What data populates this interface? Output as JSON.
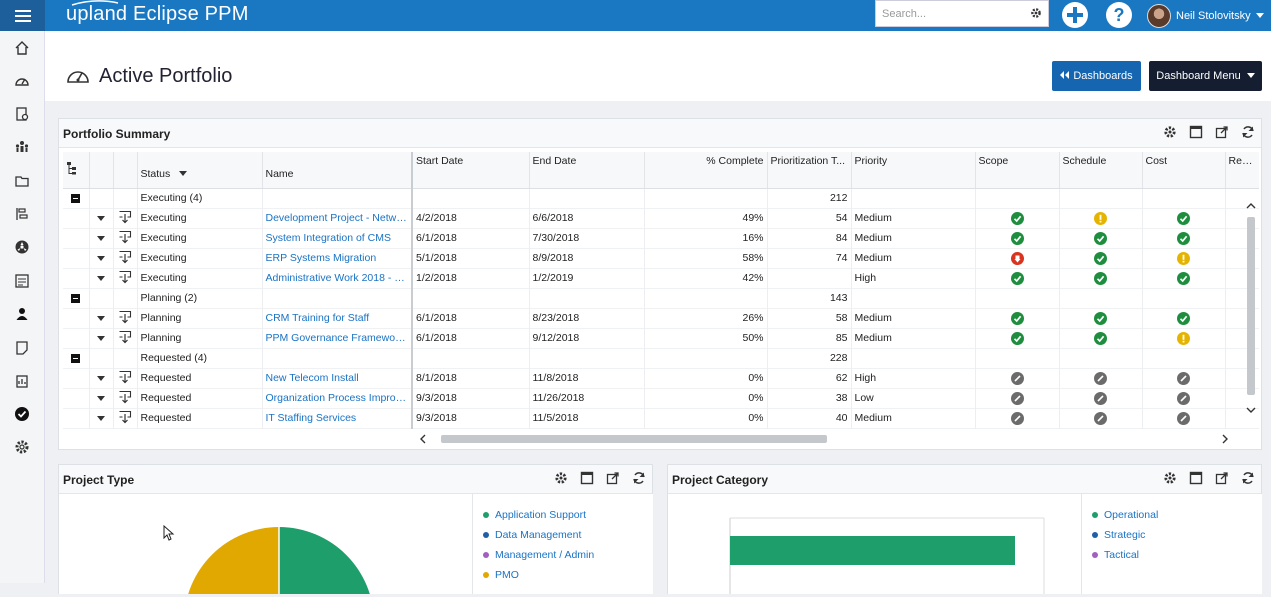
{
  "app": {
    "brand": "upland Eclipse PPM",
    "search_placeholder": "Search...",
    "user_name": "Neil Stolovitsky"
  },
  "page": {
    "title": "Active Portfolio",
    "dashboards_button": "Dashboards",
    "dashboard_menu_button": "Dashboard Menu"
  },
  "portfolio_summary": {
    "title": "Portfolio Summary",
    "columns": [
      "Status",
      "Name",
      "Start Date",
      "End Date",
      "% Complete",
      "Prioritization T...",
      "Priority",
      "Scope",
      "Schedule",
      "Cost",
      "Resou"
    ],
    "groups": [
      {
        "label": "Executing (4)",
        "total": "212",
        "rows": [
          {
            "status": "Executing",
            "name": "Development Project - Network...",
            "start": "4/2/2018",
            "end": "6/6/2018",
            "pct": "49%",
            "prio_t": "54",
            "priority": "Medium",
            "scope": "green",
            "schedule": "yellow",
            "cost": "green"
          },
          {
            "status": "Executing",
            "name": "System Integration of CMS",
            "start": "6/1/2018",
            "end": "7/30/2018",
            "pct": "16%",
            "prio_t": "84",
            "priority": "Medium",
            "scope": "green",
            "schedule": "green",
            "cost": "green"
          },
          {
            "status": "Executing",
            "name": "ERP Systems Migration",
            "start": "5/1/2018",
            "end": "8/9/2018",
            "pct": "58%",
            "prio_t": "74",
            "priority": "Medium",
            "scope": "red",
            "schedule": "green",
            "cost": "yellow"
          },
          {
            "status": "Executing",
            "name": "Administrative Work 2018 - Neil...",
            "start": "1/2/2018",
            "end": "1/2/2019",
            "pct": "42%",
            "prio_t": "",
            "priority": "High",
            "scope": "green",
            "schedule": "green",
            "cost": "green"
          }
        ]
      },
      {
        "label": "Planning (2)",
        "total": "143",
        "rows": [
          {
            "status": "Planning",
            "name": "CRM Training for Staff",
            "start": "6/1/2018",
            "end": "8/23/2018",
            "pct": "26%",
            "prio_t": "58",
            "priority": "Medium",
            "scope": "green",
            "schedule": "green",
            "cost": "green"
          },
          {
            "status": "Planning",
            "name": "PPM Governance Framework De...",
            "start": "6/1/2018",
            "end": "9/12/2018",
            "pct": "50%",
            "prio_t": "85",
            "priority": "Medium",
            "scope": "green",
            "schedule": "green",
            "cost": "yellow"
          }
        ]
      },
      {
        "label": "Requested (4)",
        "total": "228",
        "rows": [
          {
            "status": "Requested",
            "name": "New Telecom Install",
            "start": "8/1/2018",
            "end": "11/8/2018",
            "pct": "0%",
            "prio_t": "62",
            "priority": "High",
            "scope": "none",
            "schedule": "none",
            "cost": "none"
          },
          {
            "status": "Requested",
            "name": "Organization Process Improvem...",
            "start": "9/3/2018",
            "end": "11/26/2018",
            "pct": "0%",
            "prio_t": "38",
            "priority": "Low",
            "scope": "none",
            "schedule": "none",
            "cost": "none"
          },
          {
            "status": "Requested",
            "name": "IT Staffing Services",
            "start": "9/3/2018",
            "end": "11/5/2018",
            "pct": "0%",
            "prio_t": "40",
            "priority": "Medium",
            "scope": "none",
            "schedule": "none",
            "cost": "none"
          }
        ]
      }
    ]
  },
  "project_type": {
    "title": "Project Type",
    "legend": [
      {
        "label": "Application Support",
        "color": "#1e9e6a"
      },
      {
        "label": "Data Management",
        "color": "#1e5fa8"
      },
      {
        "label": "Management / Admin",
        "color": "#a35fbf"
      },
      {
        "label": "PMO",
        "color": "#e0a800"
      }
    ]
  },
  "project_category": {
    "title": "Project Category",
    "legend": [
      {
        "label": "Operational",
        "color": "#1e9e6a"
      },
      {
        "label": "Strategic",
        "color": "#1e5fa8"
      },
      {
        "label": "Tactical",
        "color": "#a35fbf"
      }
    ]
  }
}
